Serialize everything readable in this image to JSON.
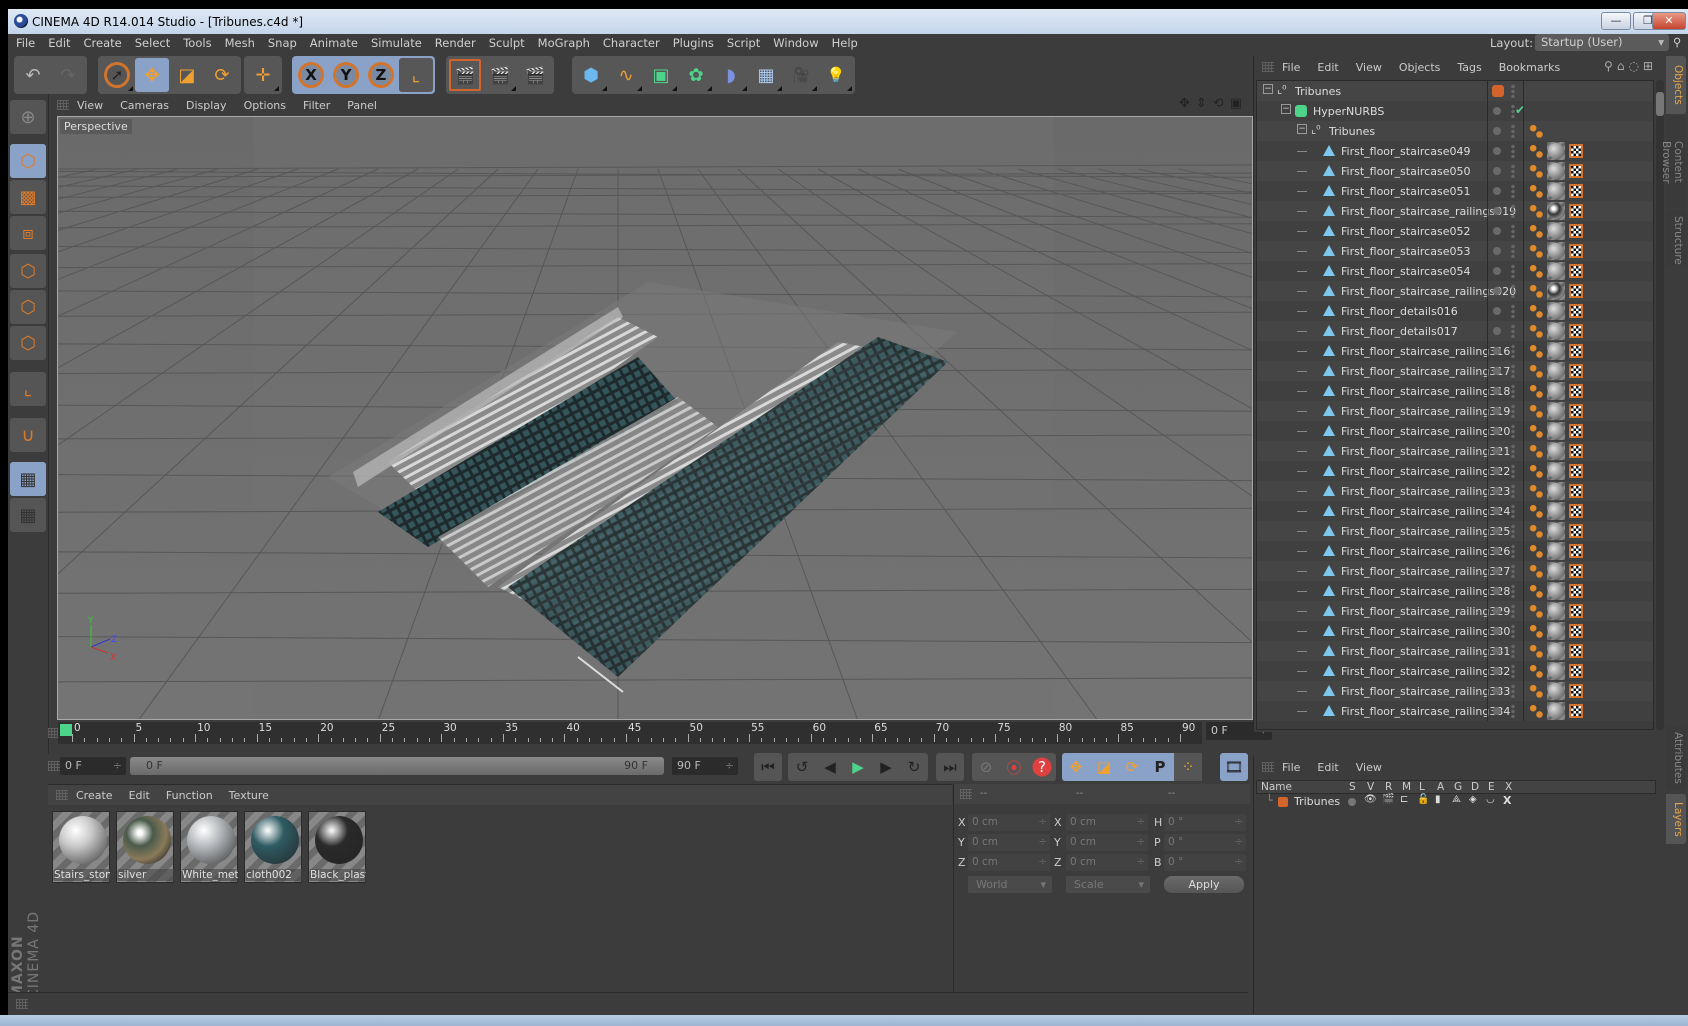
{
  "window": {
    "title": "CINEMA 4D R14.014 Studio - [Tribunes.c4d *]",
    "minimize_glyph": "—",
    "restore_glyph": "❐",
    "close_glyph": "✕"
  },
  "menubar": {
    "items": [
      "File",
      "Edit",
      "Create",
      "Select",
      "Tools",
      "Mesh",
      "Snap",
      "Animate",
      "Simulate",
      "Render",
      "Sculpt",
      "MoGraph",
      "Character",
      "Plugins",
      "Script",
      "Window",
      "Help"
    ],
    "layout_label": "Layout:",
    "layout_value": "Startup (User)"
  },
  "toolbar": {
    "groups": [
      {
        "name": "history",
        "buttons": [
          {
            "icon": "undo-icon",
            "glyph": "↶"
          },
          {
            "icon": "redo-icon",
            "glyph": "↷"
          }
        ]
      },
      {
        "name": "tools",
        "buttons": [
          {
            "icon": "live-selection-icon",
            "glyph": "➚"
          },
          {
            "icon": "move-icon",
            "glyph": "✥",
            "selected": true
          },
          {
            "icon": "scale-icon",
            "glyph": "◪"
          },
          {
            "icon": "rotate-icon",
            "glyph": "⟳"
          }
        ]
      },
      {
        "name": "recent",
        "buttons": [
          {
            "icon": "recent-tool-icon",
            "glyph": "✛"
          }
        ]
      },
      {
        "name": "axis-lock",
        "buttons": [
          {
            "icon": "x-axis-icon",
            "glyph": "X",
            "selected": true
          },
          {
            "icon": "y-axis-icon",
            "glyph": "Y",
            "selected": true
          },
          {
            "icon": "z-axis-icon",
            "glyph": "Z",
            "selected": true
          },
          {
            "icon": "coordinate-system-icon",
            "glyph": "⌞"
          }
        ]
      },
      {
        "name": "render",
        "buttons": [
          {
            "icon": "render-view-icon",
            "glyph": "🎬"
          },
          {
            "icon": "render-picture-viewer-icon",
            "glyph": "🎬"
          },
          {
            "icon": "render-settings-icon",
            "glyph": "🎬"
          }
        ]
      },
      {
        "name": "create",
        "buttons": [
          {
            "icon": "cube-icon",
            "glyph": "⬢"
          },
          {
            "icon": "spline-pen-icon",
            "glyph": "∿"
          },
          {
            "icon": "subdivision-surface-icon",
            "glyph": "▣"
          },
          {
            "icon": "cloner-icon",
            "glyph": "✿"
          },
          {
            "icon": "deformer-bend-icon",
            "glyph": "◗"
          },
          {
            "icon": "floor-icon",
            "glyph": "▦"
          },
          {
            "icon": "camera-icon",
            "glyph": "🎥"
          },
          {
            "icon": "light-icon",
            "glyph": "💡"
          }
        ]
      }
    ]
  },
  "left_toolbar": {
    "buttons": [
      {
        "icon": "make-editable-icon",
        "glyph": "⊕"
      },
      {
        "icon": "model-mode-icon",
        "glyph": "⬡",
        "selected": true
      },
      {
        "icon": "texture-mode-icon",
        "glyph": "▩"
      },
      {
        "icon": "workplane-mode-icon",
        "glyph": "⧈"
      },
      {
        "icon": "points-mode-icon",
        "glyph": "⬡"
      },
      {
        "icon": "edges-mode-icon",
        "glyph": "⬡"
      },
      {
        "icon": "polygons-mode-icon",
        "glyph": "⬡"
      },
      {
        "icon": "axis-mode-icon",
        "glyph": "⌞"
      },
      {
        "icon": "snap-magnet-icon",
        "glyph": "∪"
      },
      {
        "icon": "workplane-lock-icon",
        "glyph": "▦",
        "selected": true
      },
      {
        "icon": "workplane-align-icon",
        "glyph": "▦"
      }
    ],
    "logo_brand": "MAXON",
    "logo_product": "CINEMA 4D"
  },
  "viewport": {
    "menu": [
      "View",
      "Cameras",
      "Display",
      "Options",
      "Filter",
      "Panel"
    ],
    "label": "Perspective",
    "axis_labels": {
      "y": "Y",
      "z": "Z",
      "x": "X"
    },
    "scene_colors": {
      "background": "#6e6e6e",
      "grid": "#5a5a5a",
      "seats": "#2e4a4e",
      "stairs": "#c8c8c8"
    }
  },
  "timeline": {
    "ticks": [
      "0",
      "5",
      "10",
      "15",
      "20",
      "25",
      "30",
      "35",
      "40",
      "45",
      "50",
      "55",
      "60",
      "65",
      "70",
      "75",
      "80",
      "85",
      "90"
    ],
    "current_frame": "0 F",
    "playhead_color": "#4ed48a"
  },
  "playback": {
    "start_field": "0 F",
    "range_start": "0 F",
    "range_end": "90 F",
    "end_field": "90 F",
    "transport": [
      {
        "icon": "go-to-start-icon",
        "glyph": "⏮"
      },
      {
        "icon": "previous-key-icon",
        "glyph": "↺"
      },
      {
        "icon": "previous-frame-icon",
        "glyph": "◀"
      },
      {
        "icon": "play-icon",
        "glyph": "▶"
      },
      {
        "icon": "next-frame-icon",
        "glyph": "▶"
      },
      {
        "icon": "next-key-icon",
        "glyph": "↻"
      },
      {
        "icon": "go-to-end-icon",
        "glyph": "⏭"
      }
    ],
    "keyframe": [
      {
        "icon": "record-disabled-icon",
        "glyph": "⊘"
      },
      {
        "icon": "record-active-icon",
        "glyph": "⦿"
      },
      {
        "icon": "autokey-icon",
        "glyph": "?"
      }
    ],
    "keytracks": [
      {
        "icon": "key-position-icon",
        "glyph": "✥"
      },
      {
        "icon": "key-scale-icon",
        "glyph": "◪"
      },
      {
        "icon": "key-rotation-icon",
        "glyph": "⟳"
      },
      {
        "icon": "key-parameter-icon",
        "glyph": "P"
      },
      {
        "icon": "key-point-level-icon",
        "glyph": "⁘"
      }
    ],
    "timeline_button": {
      "icon": "timeline-window-icon",
      "glyph": "🎞"
    }
  },
  "materials": {
    "menu": [
      "Create",
      "Edit",
      "Function",
      "Texture"
    ],
    "items": [
      {
        "name": "Stairs_ston",
        "color": "#c9c9c9"
      },
      {
        "name": "silver",
        "color": "#8a8f8a"
      },
      {
        "name": "White_met",
        "color": "#b8bcc0"
      },
      {
        "name": "cloth002",
        "color": "#2f5b63"
      },
      {
        "name": "Black_plast",
        "color": "#2a2a2a"
      }
    ]
  },
  "coordinates": {
    "headers": [
      "--",
      "--",
      "--"
    ],
    "rows": [
      {
        "pos_label": "X",
        "pos": "0 cm",
        "size_label": "X",
        "size": "0 cm",
        "rot_label": "H",
        "rot": "0 °"
      },
      {
        "pos_label": "Y",
        "pos": "0 cm",
        "size_label": "Y",
        "size": "0 cm",
        "rot_label": "P",
        "rot": "0 °"
      },
      {
        "pos_label": "Z",
        "pos": "0 cm",
        "size_label": "Z",
        "size": "0 cm",
        "rot_label": "B",
        "rot": "0 °"
      }
    ],
    "space_mode": "World",
    "size_mode": "Scale",
    "apply_label": "Apply"
  },
  "object_manager": {
    "menu": [
      "File",
      "Edit",
      "View",
      "Objects",
      "Tags",
      "Bookmarks"
    ],
    "tree": [
      {
        "name": "Tribunes",
        "type": "null",
        "depth": 0,
        "layer_color": "#d2642c"
      },
      {
        "name": "HyperNURBS",
        "type": "hypernurbs",
        "depth": 1,
        "enabled": true
      },
      {
        "name": "Tribunes",
        "type": "null",
        "depth": 2,
        "tags": [
          "phong"
        ]
      },
      {
        "name": "First_floor_staircase049",
        "type": "polygon",
        "depth": 3,
        "tags": [
          "phong",
          "material",
          "uvw"
        ]
      },
      {
        "name": "First_floor_staircase050",
        "type": "polygon",
        "depth": 3,
        "tags": [
          "phong",
          "material",
          "uvw"
        ]
      },
      {
        "name": "First_floor_staircase051",
        "type": "polygon",
        "depth": 3,
        "tags": [
          "phong",
          "material",
          "uvw"
        ]
      },
      {
        "name": "First_floor_staircase_railings019",
        "type": "polygon",
        "depth": 3,
        "tags": [
          "phong",
          "material-chrome",
          "uvw"
        ]
      },
      {
        "name": "First_floor_staircase052",
        "type": "polygon",
        "depth": 3,
        "tags": [
          "phong",
          "material",
          "uvw"
        ]
      },
      {
        "name": "First_floor_staircase053",
        "type": "polygon",
        "depth": 3,
        "tags": [
          "phong",
          "material",
          "uvw"
        ]
      },
      {
        "name": "First_floor_staircase054",
        "type": "polygon",
        "depth": 3,
        "tags": [
          "phong",
          "material",
          "uvw"
        ]
      },
      {
        "name": "First_floor_staircase_railings020",
        "type": "polygon",
        "depth": 3,
        "tags": [
          "phong",
          "material-chrome",
          "uvw"
        ]
      },
      {
        "name": "First_floor_details016",
        "type": "polygon",
        "depth": 3,
        "tags": [
          "phong",
          "material",
          "uvw"
        ]
      },
      {
        "name": "First_floor_details017",
        "type": "polygon",
        "depth": 3,
        "tags": [
          "phong",
          "material",
          "uvw"
        ]
      },
      {
        "name": "First_floor_staircase_railing316",
        "type": "polygon",
        "depth": 3,
        "tags": [
          "phong",
          "material",
          "uvw"
        ]
      },
      {
        "name": "First_floor_staircase_railing317",
        "type": "polygon",
        "depth": 3,
        "tags": [
          "phong",
          "material",
          "uvw"
        ]
      },
      {
        "name": "First_floor_staircase_railing318",
        "type": "polygon",
        "depth": 3,
        "tags": [
          "phong",
          "material",
          "uvw"
        ]
      },
      {
        "name": "First_floor_staircase_railing319",
        "type": "polygon",
        "depth": 3,
        "tags": [
          "phong",
          "material",
          "uvw"
        ]
      },
      {
        "name": "First_floor_staircase_railing320",
        "type": "polygon",
        "depth": 3,
        "tags": [
          "phong",
          "material",
          "uvw"
        ]
      },
      {
        "name": "First_floor_staircase_railing321",
        "type": "polygon",
        "depth": 3,
        "tags": [
          "phong",
          "material",
          "uvw"
        ]
      },
      {
        "name": "First_floor_staircase_railing322",
        "type": "polygon",
        "depth": 3,
        "tags": [
          "phong",
          "material",
          "uvw"
        ]
      },
      {
        "name": "First_floor_staircase_railing323",
        "type": "polygon",
        "depth": 3,
        "tags": [
          "phong",
          "material",
          "uvw"
        ]
      },
      {
        "name": "First_floor_staircase_railing324",
        "type": "polygon",
        "depth": 3,
        "tags": [
          "phong",
          "material",
          "uvw"
        ]
      },
      {
        "name": "First_floor_staircase_railing325",
        "type": "polygon",
        "depth": 3,
        "tags": [
          "phong",
          "material",
          "uvw"
        ]
      },
      {
        "name": "First_floor_staircase_railing326",
        "type": "polygon",
        "depth": 3,
        "tags": [
          "phong",
          "material",
          "uvw"
        ]
      },
      {
        "name": "First_floor_staircase_railing327",
        "type": "polygon",
        "depth": 3,
        "tags": [
          "phong",
          "material",
          "uvw"
        ]
      },
      {
        "name": "First_floor_staircase_railing328",
        "type": "polygon",
        "depth": 3,
        "tags": [
          "phong",
          "material",
          "uvw"
        ]
      },
      {
        "name": "First_floor_staircase_railing329",
        "type": "polygon",
        "depth": 3,
        "tags": [
          "phong",
          "material",
          "uvw"
        ]
      },
      {
        "name": "First_floor_staircase_railing330",
        "type": "polygon",
        "depth": 3,
        "tags": [
          "phong",
          "material",
          "uvw"
        ]
      },
      {
        "name": "First_floor_staircase_railing331",
        "type": "polygon",
        "depth": 3,
        "tags": [
          "phong",
          "material",
          "uvw"
        ]
      },
      {
        "name": "First_floor_staircase_railing332",
        "type": "polygon",
        "depth": 3,
        "tags": [
          "phong",
          "material",
          "uvw"
        ]
      },
      {
        "name": "First_floor_staircase_railing333",
        "type": "polygon",
        "depth": 3,
        "tags": [
          "phong",
          "material",
          "uvw"
        ]
      },
      {
        "name": "First_floor_staircase_railing334",
        "type": "polygon",
        "depth": 3,
        "tags": [
          "phong",
          "material",
          "uvw"
        ]
      }
    ]
  },
  "side_tabs": {
    "top": [
      {
        "label": "Objects",
        "active": true
      },
      {
        "label": "Content Browser"
      },
      {
        "label": "Structure"
      }
    ],
    "bottom": [
      {
        "label": "Attributes"
      },
      {
        "label": "Layers",
        "active": true
      }
    ]
  },
  "layer_manager": {
    "menu": [
      "File",
      "Edit",
      "View"
    ],
    "columns": [
      "Name",
      "S",
      "V",
      "R",
      "M",
      "L",
      "A",
      "G",
      "D",
      "E",
      "X"
    ],
    "layers": [
      {
        "name": "Tribunes",
        "color": "#d2642c"
      }
    ]
  }
}
